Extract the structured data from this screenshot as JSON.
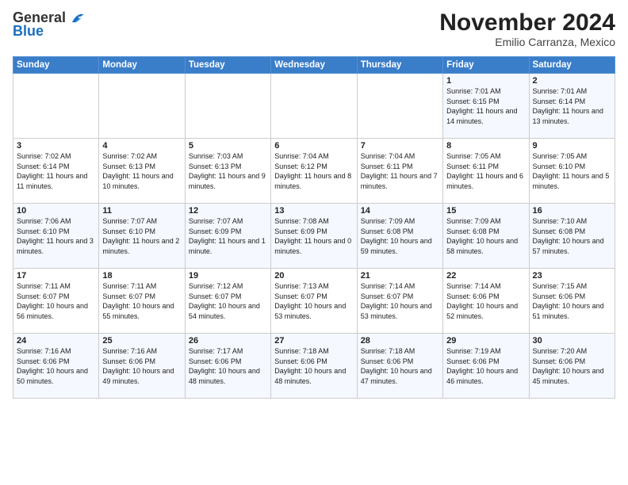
{
  "header": {
    "logo_general": "General",
    "logo_blue": "Blue",
    "month_year": "November 2024",
    "location": "Emilio Carranza, Mexico"
  },
  "weekdays": [
    "Sunday",
    "Monday",
    "Tuesday",
    "Wednesday",
    "Thursday",
    "Friday",
    "Saturday"
  ],
  "weeks": [
    [
      {
        "day": "",
        "info": ""
      },
      {
        "day": "",
        "info": ""
      },
      {
        "day": "",
        "info": ""
      },
      {
        "day": "",
        "info": ""
      },
      {
        "day": "",
        "info": ""
      },
      {
        "day": "1",
        "info": "Sunrise: 7:01 AM\nSunset: 6:15 PM\nDaylight: 11 hours and 14 minutes."
      },
      {
        "day": "2",
        "info": "Sunrise: 7:01 AM\nSunset: 6:14 PM\nDaylight: 11 hours and 13 minutes."
      }
    ],
    [
      {
        "day": "3",
        "info": "Sunrise: 7:02 AM\nSunset: 6:14 PM\nDaylight: 11 hours and 11 minutes."
      },
      {
        "day": "4",
        "info": "Sunrise: 7:02 AM\nSunset: 6:13 PM\nDaylight: 11 hours and 10 minutes."
      },
      {
        "day": "5",
        "info": "Sunrise: 7:03 AM\nSunset: 6:13 PM\nDaylight: 11 hours and 9 minutes."
      },
      {
        "day": "6",
        "info": "Sunrise: 7:04 AM\nSunset: 6:12 PM\nDaylight: 11 hours and 8 minutes."
      },
      {
        "day": "7",
        "info": "Sunrise: 7:04 AM\nSunset: 6:11 PM\nDaylight: 11 hours and 7 minutes."
      },
      {
        "day": "8",
        "info": "Sunrise: 7:05 AM\nSunset: 6:11 PM\nDaylight: 11 hours and 6 minutes."
      },
      {
        "day": "9",
        "info": "Sunrise: 7:05 AM\nSunset: 6:10 PM\nDaylight: 11 hours and 5 minutes."
      }
    ],
    [
      {
        "day": "10",
        "info": "Sunrise: 7:06 AM\nSunset: 6:10 PM\nDaylight: 11 hours and 3 minutes."
      },
      {
        "day": "11",
        "info": "Sunrise: 7:07 AM\nSunset: 6:10 PM\nDaylight: 11 hours and 2 minutes."
      },
      {
        "day": "12",
        "info": "Sunrise: 7:07 AM\nSunset: 6:09 PM\nDaylight: 11 hours and 1 minute."
      },
      {
        "day": "13",
        "info": "Sunrise: 7:08 AM\nSunset: 6:09 PM\nDaylight: 11 hours and 0 minutes."
      },
      {
        "day": "14",
        "info": "Sunrise: 7:09 AM\nSunset: 6:08 PM\nDaylight: 10 hours and 59 minutes."
      },
      {
        "day": "15",
        "info": "Sunrise: 7:09 AM\nSunset: 6:08 PM\nDaylight: 10 hours and 58 minutes."
      },
      {
        "day": "16",
        "info": "Sunrise: 7:10 AM\nSunset: 6:08 PM\nDaylight: 10 hours and 57 minutes."
      }
    ],
    [
      {
        "day": "17",
        "info": "Sunrise: 7:11 AM\nSunset: 6:07 PM\nDaylight: 10 hours and 56 minutes."
      },
      {
        "day": "18",
        "info": "Sunrise: 7:11 AM\nSunset: 6:07 PM\nDaylight: 10 hours and 55 minutes."
      },
      {
        "day": "19",
        "info": "Sunrise: 7:12 AM\nSunset: 6:07 PM\nDaylight: 10 hours and 54 minutes."
      },
      {
        "day": "20",
        "info": "Sunrise: 7:13 AM\nSunset: 6:07 PM\nDaylight: 10 hours and 53 minutes."
      },
      {
        "day": "21",
        "info": "Sunrise: 7:14 AM\nSunset: 6:07 PM\nDaylight: 10 hours and 53 minutes."
      },
      {
        "day": "22",
        "info": "Sunrise: 7:14 AM\nSunset: 6:06 PM\nDaylight: 10 hours and 52 minutes."
      },
      {
        "day": "23",
        "info": "Sunrise: 7:15 AM\nSunset: 6:06 PM\nDaylight: 10 hours and 51 minutes."
      }
    ],
    [
      {
        "day": "24",
        "info": "Sunrise: 7:16 AM\nSunset: 6:06 PM\nDaylight: 10 hours and 50 minutes."
      },
      {
        "day": "25",
        "info": "Sunrise: 7:16 AM\nSunset: 6:06 PM\nDaylight: 10 hours and 49 minutes."
      },
      {
        "day": "26",
        "info": "Sunrise: 7:17 AM\nSunset: 6:06 PM\nDaylight: 10 hours and 48 minutes."
      },
      {
        "day": "27",
        "info": "Sunrise: 7:18 AM\nSunset: 6:06 PM\nDaylight: 10 hours and 48 minutes."
      },
      {
        "day": "28",
        "info": "Sunrise: 7:18 AM\nSunset: 6:06 PM\nDaylight: 10 hours and 47 minutes."
      },
      {
        "day": "29",
        "info": "Sunrise: 7:19 AM\nSunset: 6:06 PM\nDaylight: 10 hours and 46 minutes."
      },
      {
        "day": "30",
        "info": "Sunrise: 7:20 AM\nSunset: 6:06 PM\nDaylight: 10 hours and 45 minutes."
      }
    ]
  ]
}
